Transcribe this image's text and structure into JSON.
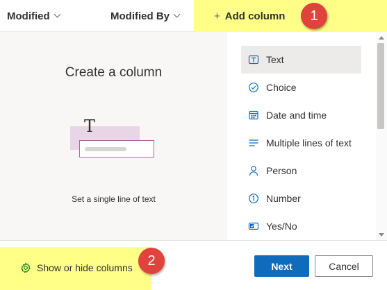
{
  "header": {
    "col_modified": "Modified",
    "col_modified_by": "Modified By",
    "add_column": "Add column",
    "add_icon": "+"
  },
  "badges": {
    "one": "1",
    "two": "2"
  },
  "preview": {
    "title": "Create a column",
    "illustration_glyph": "T",
    "description": "Set a single line of text"
  },
  "options": [
    {
      "label": "Text",
      "icon": "text-icon",
      "selected": true
    },
    {
      "label": "Choice",
      "icon": "choice-icon",
      "selected": false
    },
    {
      "label": "Date and time",
      "icon": "calendar-icon",
      "selected": false
    },
    {
      "label": "Multiple lines of text",
      "icon": "multiline-icon",
      "selected": false
    },
    {
      "label": "Person",
      "icon": "person-icon",
      "selected": false
    },
    {
      "label": "Number",
      "icon": "number-icon",
      "selected": false
    },
    {
      "label": "Yes/No",
      "icon": "yes-no-icon",
      "selected": false
    }
  ],
  "footer": {
    "show_hide": "Show or hide columns",
    "next": "Next",
    "cancel": "Cancel"
  },
  "colors": {
    "accent": "#0f6cbd",
    "highlight": "#ffff88",
    "badge": "#e0433b"
  }
}
